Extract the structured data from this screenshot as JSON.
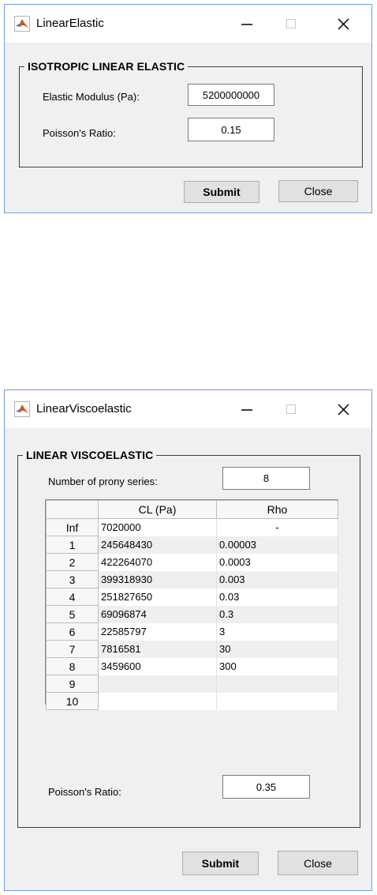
{
  "window1": {
    "title": "LinearElastic",
    "group_title": "ISOTROPIC LINEAR ELASTIC",
    "modulus_label": "Elastic Modulus (Pa):",
    "modulus_value": "5200000000",
    "poisson_label": "Poisson's Ratio:",
    "poisson_value": "0.15",
    "submit_label": "Submit",
    "close_label": "Close"
  },
  "window2": {
    "title": "LinearViscoelastic",
    "group_title": "LINEAR VISCOELASTIC",
    "prony_label": "Number of prony series:",
    "prony_value": "8",
    "table": {
      "columns": [
        "CL (Pa)",
        "Rho"
      ],
      "rows": [
        {
          "header": "Inf",
          "cl": "7020000",
          "rho": "-"
        },
        {
          "header": "1",
          "cl": "245648430",
          "rho": "0.00003"
        },
        {
          "header": "2",
          "cl": "422264070",
          "rho": "0.0003"
        },
        {
          "header": "3",
          "cl": "399318930",
          "rho": "0.003"
        },
        {
          "header": "4",
          "cl": "251827650",
          "rho": "0.03"
        },
        {
          "header": "5",
          "cl": "69096874",
          "rho": "0.3"
        },
        {
          "header": "6",
          "cl": "22585797",
          "rho": "3"
        },
        {
          "header": "7",
          "cl": "7816581",
          "rho": "30"
        },
        {
          "header": "8",
          "cl": "3459600",
          "rho": "300"
        },
        {
          "header": "9",
          "cl": "",
          "rho": ""
        },
        {
          "header": "10",
          "cl": "",
          "rho": ""
        }
      ]
    },
    "poisson_label": "Poisson's Ratio:",
    "poisson_value": "0.35",
    "submit_label": "Submit",
    "close_label": "Close"
  },
  "icons": {
    "app": "matlab-icon",
    "minimize": "minimize-icon",
    "maximize": "maximize-icon",
    "close": "close-icon"
  },
  "colors": {
    "window_border": "#6f9fd8",
    "window_body": "#f0f0f0",
    "titlebar": "#ffffff"
  }
}
